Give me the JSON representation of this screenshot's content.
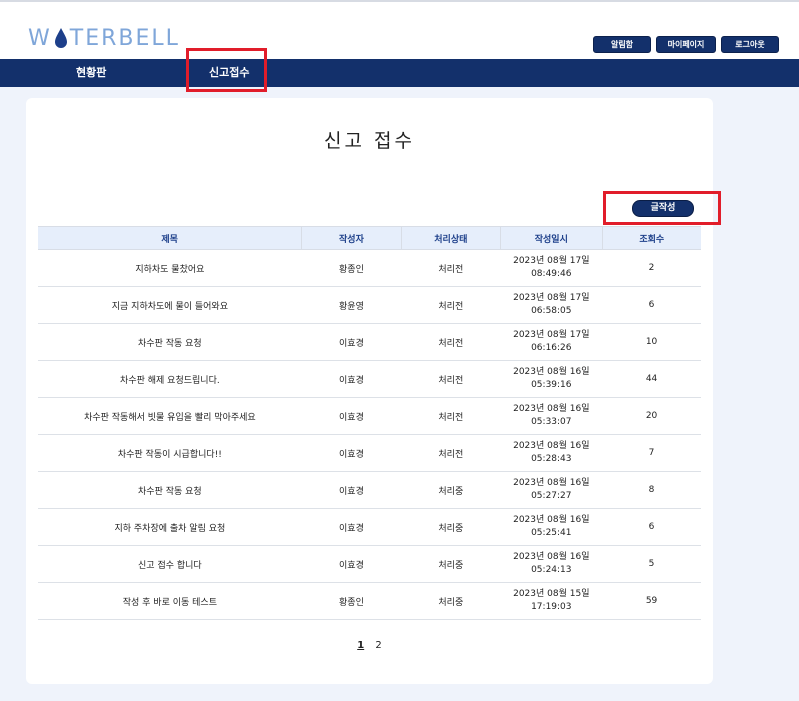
{
  "app": {
    "logo_parts": [
      "W",
      "TERBELL"
    ],
    "logo_color": "#7fa6d9"
  },
  "header": {
    "buttons": [
      "알림함",
      "마이페이지",
      "로그아웃"
    ]
  },
  "nav": {
    "items": [
      "현황판",
      "신고접수"
    ],
    "active": "신고접수"
  },
  "main": {
    "title": "신고 접수",
    "write_button": "글작성",
    "columns": [
      "제목",
      "작성자",
      "처리상태",
      "작성일시",
      "조회수"
    ],
    "rows": [
      {
        "title": "지하차도 물찼어요",
        "author": "황종인",
        "status": "처리전",
        "date": "2023년 08월 17일",
        "time": "08:49:46",
        "views": "2"
      },
      {
        "title": "지금 지하차도에 물이 들어와요",
        "author": "황윤영",
        "status": "처리전",
        "date": "2023년 08월 17일",
        "time": "06:58:05",
        "views": "6"
      },
      {
        "title": "차수판 작동 요청",
        "author": "이효경",
        "status": "처리전",
        "date": "2023년 08월 17일",
        "time": "06:16:26",
        "views": "10"
      },
      {
        "title": "차수판 해제 요청드립니다.",
        "author": "이효경",
        "status": "처리전",
        "date": "2023년 08월 16일",
        "time": "05:39:16",
        "views": "44"
      },
      {
        "title": "차수판 작동해서 빗물 유입을 빨리 막아주세요",
        "author": "이효경",
        "status": "처리전",
        "date": "2023년 08월 16일",
        "time": "05:33:07",
        "views": "20"
      },
      {
        "title": "차수판 작동이 시급합니다!!",
        "author": "이효경",
        "status": "처리전",
        "date": "2023년 08월 16일",
        "time": "05:28:43",
        "views": "7"
      },
      {
        "title": "차수판 작동 요청",
        "author": "이효경",
        "status": "처리중",
        "date": "2023년 08월 16일",
        "time": "05:27:27",
        "views": "8"
      },
      {
        "title": "지하 주차장에 출차 알림 요청",
        "author": "이효경",
        "status": "처리중",
        "date": "2023년 08월 16일",
        "time": "05:25:41",
        "views": "6"
      },
      {
        "title": "신고 접수 합니다",
        "author": "이효경",
        "status": "처리중",
        "date": "2023년 08월 16일",
        "time": "05:24:13",
        "views": "5"
      },
      {
        "title": "작성 후 바로 이동 테스트",
        "author": "황종인",
        "status": "처리중",
        "date": "2023년 08월 15일",
        "time": "17:19:03",
        "views": "59"
      }
    ],
    "status_colors": {
      "처리전": "#c0262d",
      "처리중": "#1f7a3a"
    },
    "pagination": {
      "pages": [
        "1",
        "2"
      ],
      "current": "1"
    }
  },
  "colors": {
    "navy": "#13306b",
    "highlight": "#e11d2a",
    "table_header_bg": "#e6eefb"
  }
}
